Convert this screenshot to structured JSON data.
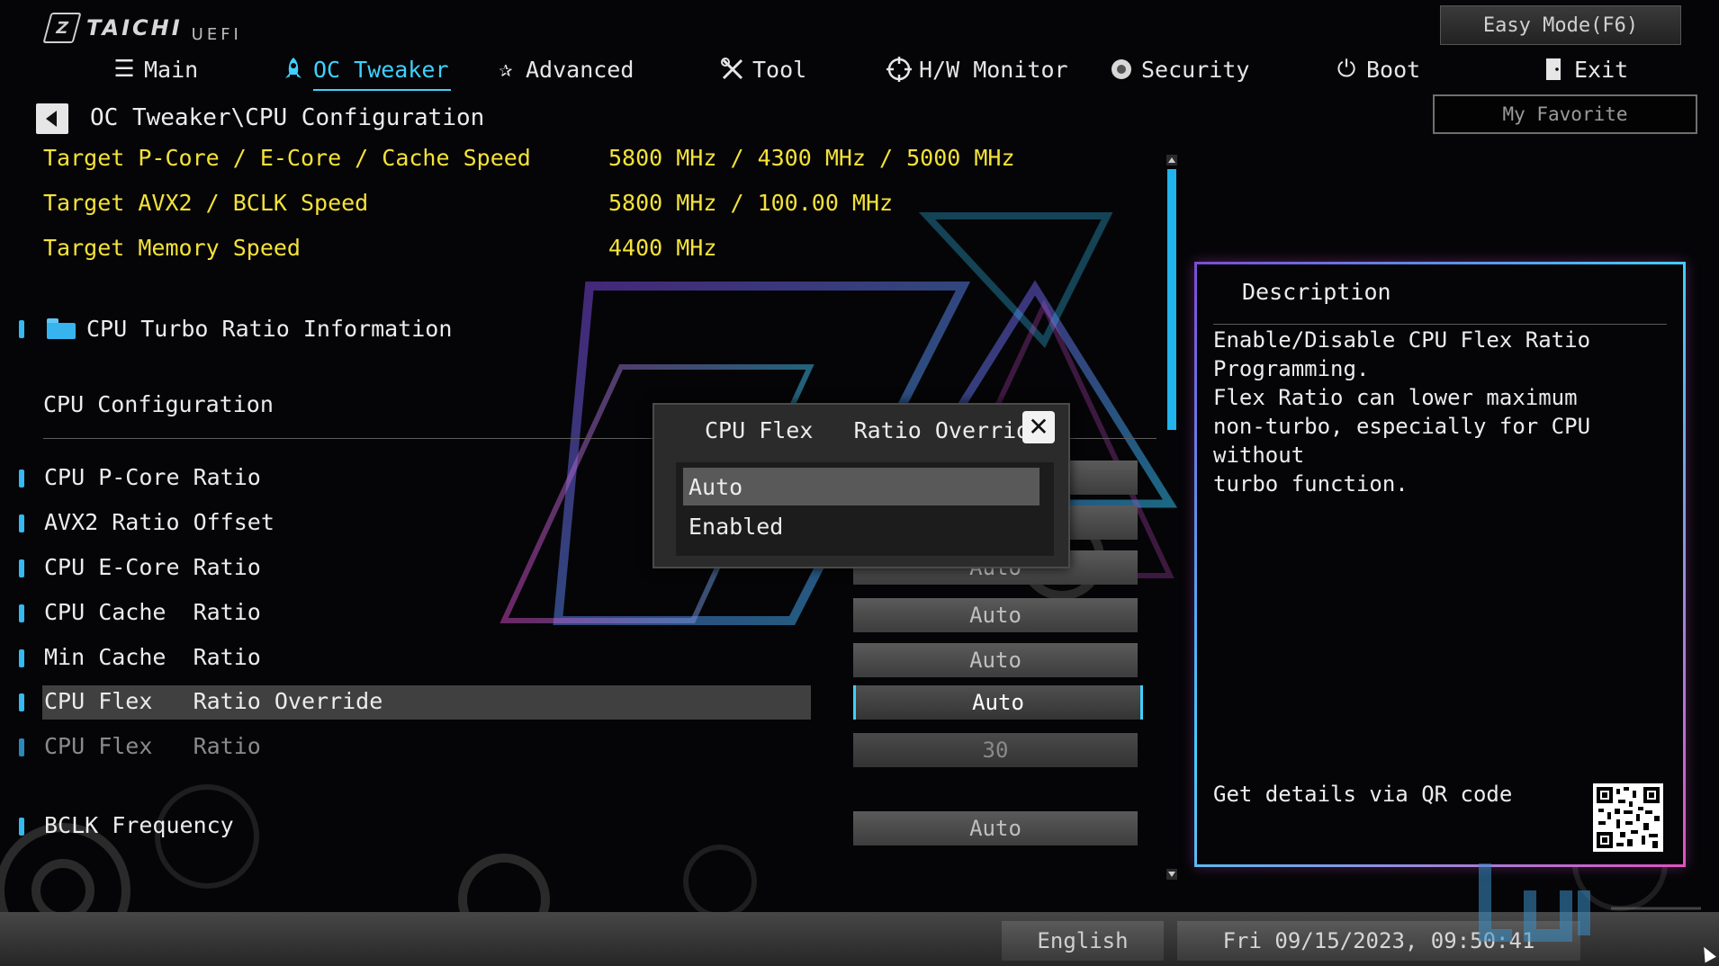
{
  "header": {
    "brand": "TAICHI",
    "brand_sub": "UEFI",
    "easy_mode_label": "Easy Mode(F6)",
    "favorite_label": "My Favorite",
    "nav": [
      {
        "label": "Main",
        "icon": "list-icon"
      },
      {
        "label": "OC Tweaker",
        "icon": "rocket-icon",
        "active": true
      },
      {
        "label": "Advanced",
        "icon": "star-icon"
      },
      {
        "label": "Tool",
        "icon": "tools-icon"
      },
      {
        "label": "H/W Monitor",
        "icon": "crosshair-icon"
      },
      {
        "label": "Security",
        "icon": "shield-icon"
      },
      {
        "label": "Boot",
        "icon": "power-icon"
      },
      {
        "label": "Exit",
        "icon": "exit-door-icon"
      }
    ]
  },
  "breadcrumb": "OC Tweaker\\CPU Configuration",
  "info_rows": [
    {
      "label": "Target P-Core / E-Core / Cache Speed",
      "value": "5800 MHz / 4300 MHz / 5000 MHz"
    },
    {
      "label": "Target AVX2 / BCLK Speed",
      "value": "5800 MHz / 100.00 MHz"
    },
    {
      "label": "Target Memory Speed",
      "value": "4400 MHz"
    }
  ],
  "submenu": {
    "label": "CPU Turbo Ratio Information"
  },
  "section_title": "CPU Configuration",
  "settings": [
    {
      "label": "CPU P-Core Ratio",
      "value": ""
    },
    {
      "label": "AVX2 Ratio Offset",
      "value": ""
    },
    {
      "label": "CPU E-Core Ratio",
      "value": "Auto"
    },
    {
      "label": "CPU Cache  Ratio",
      "value": "Auto"
    },
    {
      "label": "Min Cache  Ratio",
      "value": "Auto"
    },
    {
      "label": "CPU Flex   Ratio Override",
      "value": "Auto"
    },
    {
      "label": "CPU Flex   Ratio",
      "value": "30"
    },
    {
      "label": "BCLK Frequency",
      "value": "Auto"
    }
  ],
  "popup": {
    "title": "CPU Flex   Ratio Override",
    "options": [
      "Auto",
      "Enabled"
    ],
    "selected": "Auto"
  },
  "description": {
    "title": "Description",
    "text": "Enable/Disable CPU Flex Ratio\nProgramming.\nFlex Ratio can lower maximum\nnon-turbo, especially for CPU without\nturbo function.",
    "qr_label": "Get details via QR code"
  },
  "footer": {
    "language": "English",
    "datetime": "Fri 09/15/2023, 09:50:41"
  },
  "colors": {
    "accent": "#3fd0ff",
    "highlight_text": "#f4e23a",
    "marker": "#36b8f0"
  }
}
